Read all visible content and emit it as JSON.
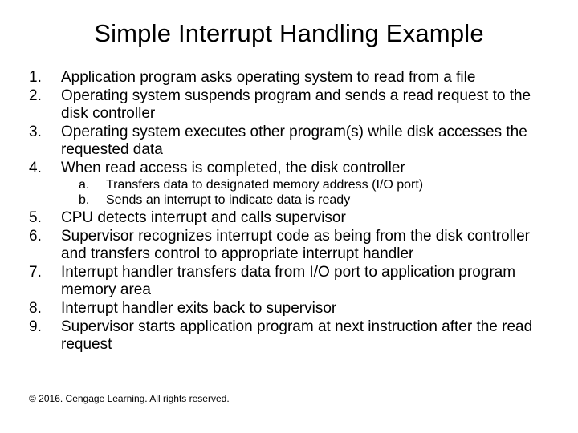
{
  "title": "Simple Interrupt Handling Example",
  "items": [
    {
      "n": "1.",
      "t": "Application program asks operating system to read from a file"
    },
    {
      "n": "2.",
      "t": "Operating system suspends program and sends a read request to the disk controller"
    },
    {
      "n": "3.",
      "t": "Operating system executes other program(s) while disk accesses the requested data"
    },
    {
      "n": "4.",
      "t": "When read access is completed, the disk controller"
    }
  ],
  "subitems": [
    {
      "n": "a.",
      "t": "Transfers data to designated memory address (I/O port)"
    },
    {
      "n": "b.",
      "t": "Sends an interrupt to indicate data is ready"
    }
  ],
  "items2": [
    {
      "n": "5.",
      "t": "CPU detects interrupt and calls supervisor"
    },
    {
      "n": "6.",
      "t": "Supervisor recognizes interrupt code as being from the disk controller and transfers control to appropriate interrupt handler"
    },
    {
      "n": "7.",
      "t": "Interrupt handler transfers data from I/O port to application program memory area"
    },
    {
      "n": "8.",
      "t": "Interrupt handler exits back to supervisor"
    },
    {
      "n": "9.",
      "t": "Supervisor starts application program at next instruction after the read request"
    }
  ],
  "footer": "© 2016. Cengage Learning. All rights reserved."
}
